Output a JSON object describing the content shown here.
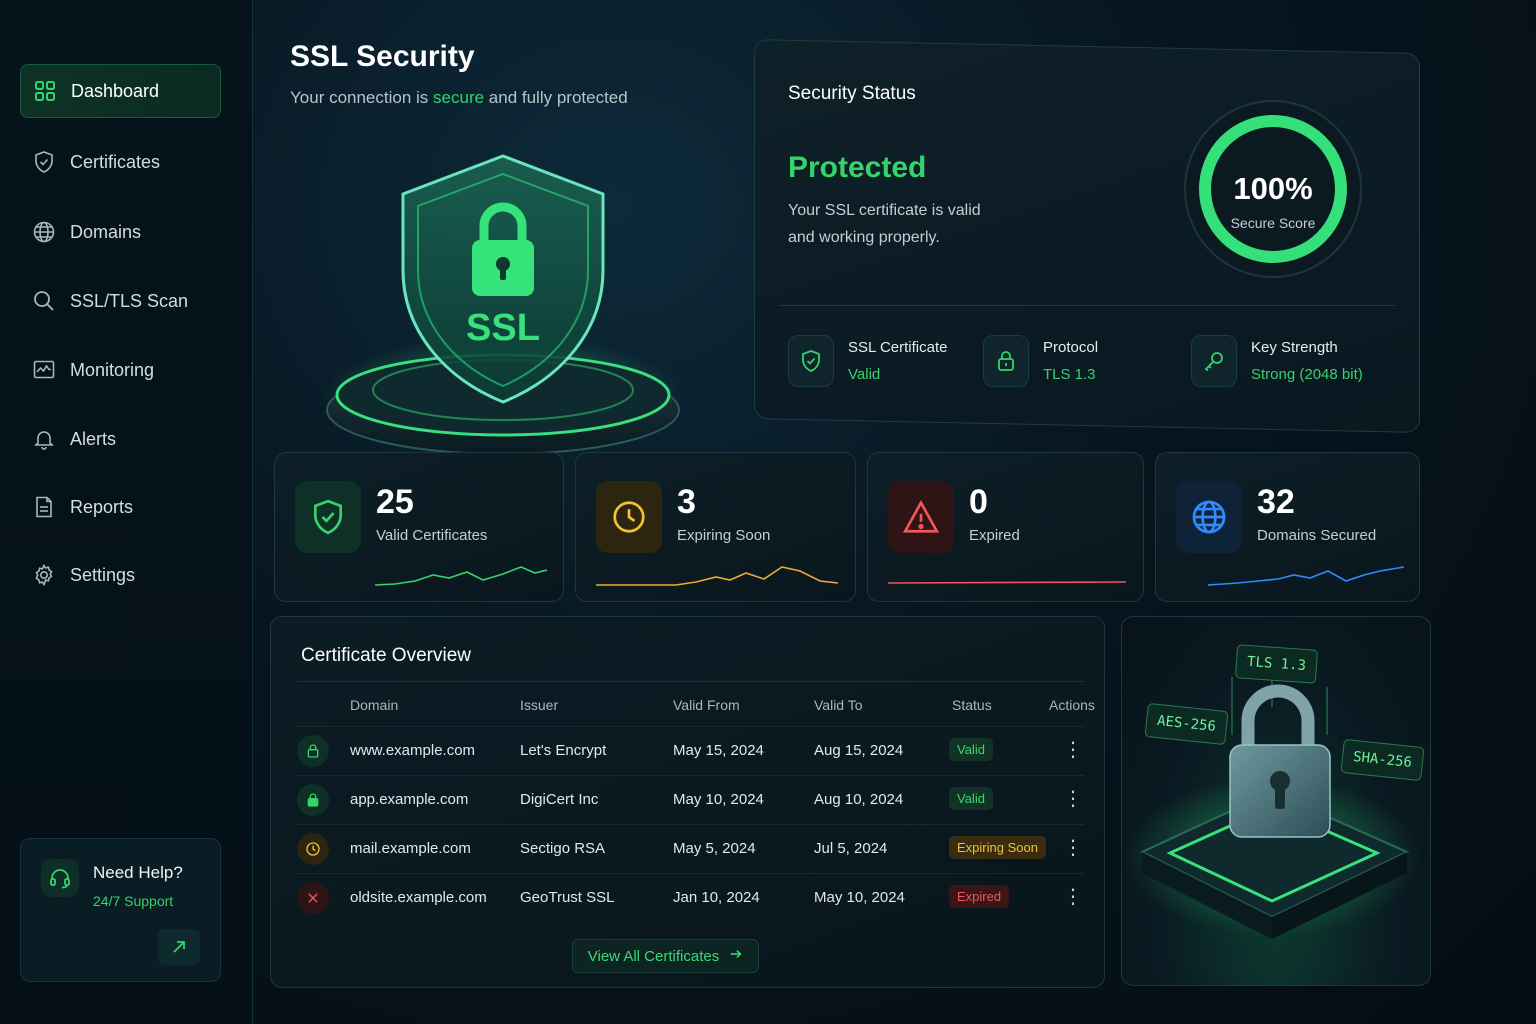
{
  "sidebar": {
    "items": [
      {
        "label": "Dashboard",
        "icon": "grid-icon",
        "active": true
      },
      {
        "label": "Certificates",
        "icon": "shield-icon"
      },
      {
        "label": "Domains",
        "icon": "globe-icon"
      },
      {
        "label": "SSL/TLS Scan",
        "icon": "search-icon"
      },
      {
        "label": "Monitoring",
        "icon": "monitor-icon"
      },
      {
        "label": "Alerts",
        "icon": "bell-icon"
      },
      {
        "label": "Reports",
        "icon": "document-icon"
      },
      {
        "label": "Settings",
        "icon": "gear-icon"
      }
    ],
    "help": {
      "title": "Need Help?",
      "subtitle": "24/7 Support",
      "icon": "headset-icon",
      "arrow_icon": "arrow-up-right-icon"
    }
  },
  "header": {
    "title": "SSL Security",
    "subtitle_pre": "Your connection is ",
    "subtitle_accent": "secure",
    "subtitle_post": " and fully protected"
  },
  "hero": {
    "badge_text": "SSL"
  },
  "security_status": {
    "title": "Security Status",
    "state": "Protected",
    "description_line1": "Your SSL certificate is valid",
    "description_line2": "and working properly.",
    "score": "100%",
    "score_value": 1.0,
    "score_label": "Secure Score",
    "items": [
      {
        "label": "SSL Certificate",
        "value": "Valid",
        "icon": "shield-check-icon"
      },
      {
        "label": "Protocol",
        "value": "TLS 1.3",
        "icon": "lock-icon"
      },
      {
        "label": "Key Strength",
        "value": "Strong (2048 bit)",
        "icon": "key-icon"
      }
    ]
  },
  "stats": [
    {
      "value": "25",
      "label": "Valid Certificates",
      "icon": "shield-check-icon",
      "color": "#34d36b"
    },
    {
      "value": "3",
      "label": "Expiring Soon",
      "icon": "clock-icon",
      "color": "#f2c233"
    },
    {
      "value": "0",
      "label": "Expired",
      "icon": "warning-icon",
      "color": "#f0565a"
    },
    {
      "value": "32",
      "label": "Domains Secured",
      "icon": "globe-icon",
      "color": "#2f8cff"
    }
  ],
  "certificates": {
    "title": "Certificate Overview",
    "columns": [
      "Domain",
      "Issuer",
      "Valid From",
      "Valid To",
      "Status",
      "Actions"
    ],
    "rows": [
      {
        "domain": "www.example.com",
        "issuer": "Let's Encrypt",
        "from": "May 15, 2024",
        "to": "Aug 15, 2024",
        "status": "Valid",
        "kind": "valid"
      },
      {
        "domain": "app.example.com",
        "issuer": "DigiCert Inc",
        "from": "May 10, 2024",
        "to": "Aug 10, 2024",
        "status": "Valid",
        "kind": "valid"
      },
      {
        "domain": "mail.example.com",
        "issuer": "Sectigo RSA",
        "from": "May 5, 2024",
        "to": "Jul 5, 2024",
        "status": "Expiring Soon",
        "kind": "expiring"
      },
      {
        "domain": "oldsite.example.com",
        "issuer": "GeoTrust SSL",
        "from": "Jan 10, 2024",
        "to": "May 10, 2024",
        "status": "Expired",
        "kind": "expired"
      }
    ],
    "view_all": "View All Certificates"
  },
  "illustration": {
    "tags": [
      "TLS 1.3",
      "AES-256",
      "SHA-256"
    ]
  },
  "colors": {
    "accent": "#34d36b",
    "warning": "#f2c233",
    "danger": "#f0565a",
    "info": "#2f8cff"
  }
}
